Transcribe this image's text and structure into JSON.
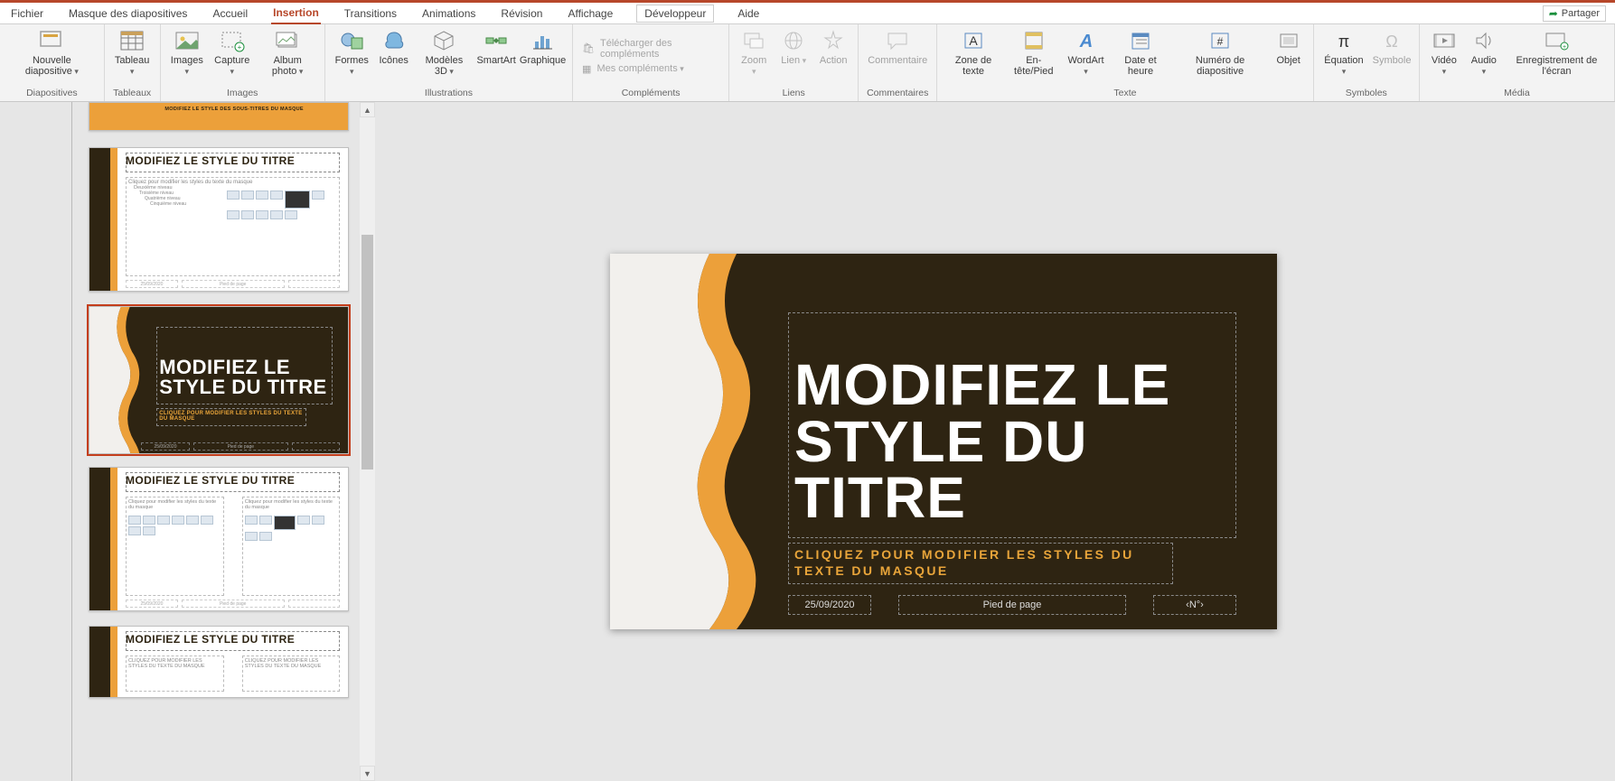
{
  "colors": {
    "accent": "#b7472a",
    "orange": "#eca03a",
    "dark": "#2e2412"
  },
  "tabs": {
    "items": [
      "Fichier",
      "Masque des diapositives",
      "Accueil",
      "Insertion",
      "Transitions",
      "Animations",
      "Révision",
      "Affichage",
      "Développeur",
      "Aide"
    ],
    "active_index": 3,
    "share": "Partager"
  },
  "ribbon": {
    "groups": {
      "diapositives": {
        "label": "Diapositives",
        "new_slide": "Nouvelle diapositive"
      },
      "tableaux": {
        "label": "Tableaux",
        "tableau": "Tableau"
      },
      "images": {
        "label": "Images",
        "images": "Images",
        "capture": "Capture",
        "album": "Album photo"
      },
      "illustrations": {
        "label": "Illustrations",
        "formes": "Formes",
        "icones": "Icônes",
        "modeles3d": "Modèles 3D",
        "smartart": "SmartArt",
        "graphique": "Graphique"
      },
      "complements": {
        "label": "Compléments",
        "download": "Télécharger des compléments",
        "mine": "Mes compléments"
      },
      "liens": {
        "label": "Liens",
        "zoom": "Zoom",
        "lien": "Lien",
        "action": "Action"
      },
      "commentaires": {
        "label": "Commentaires",
        "commentaire": "Commentaire"
      },
      "texte": {
        "label": "Texte",
        "zone": "Zone de texte",
        "entete": "En-tête/Pied",
        "wordart": "WordArt",
        "date": "Date et heure",
        "numero": "Numéro de diapositive",
        "objet": "Objet"
      },
      "symboles": {
        "label": "Symboles",
        "equation": "Équation",
        "symbole": "Symbole"
      },
      "media": {
        "label": "Média",
        "video": "Vidéo",
        "audio": "Audio",
        "enreg": "Enregistrement de l'écran"
      }
    }
  },
  "slide": {
    "title": "MODIFIEZ LE STYLE DU TITRE",
    "subtitle": "CLIQUEZ POUR MODIFIER LES STYLES DU TEXTE DU MASQUE",
    "date": "25/09/2020",
    "footer": "Pied de page",
    "pagenum": "‹N°›"
  },
  "thumbs": {
    "title_text": "MODIFIEZ LE STYLE DU TITRE",
    "subtitle_sm": "MODIFIEZ LE STYLE DES SOUS-TITRES DU MASQUE",
    "sub_text": "CLIQUEZ POUR MODIFIER LES STYLES DU TEXTE DU MASQUE",
    "bullet1": "Cliquez pour modifier les styles du texte du masque",
    "bullet2": "Deuxième niveau",
    "bullet3": "Troisième niveau",
    "bullet4": "Quatrième niveau",
    "bullet5": "Cinquième niveau",
    "two_col": "Cliquez pour modifier les styles du texte du masque",
    "footer": "Pied de page",
    "date": "25/09/2020"
  }
}
